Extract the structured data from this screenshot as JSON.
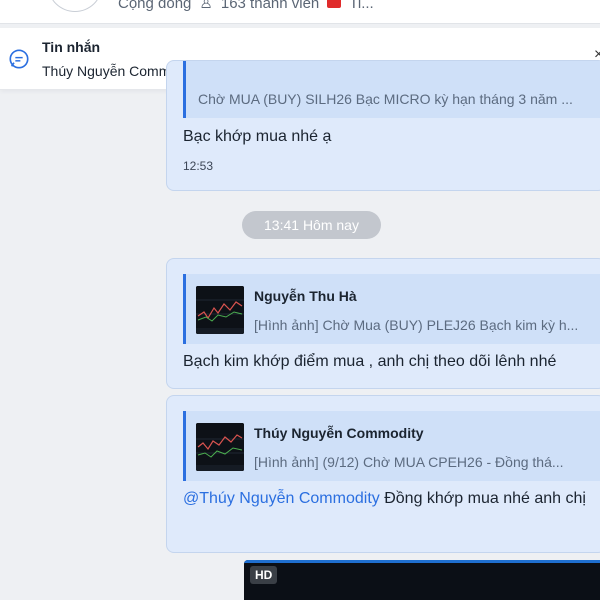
{
  "group_header": {
    "community_label": "Cộng đồng",
    "members_label": "163 thành viên",
    "extra_label": "Ti..."
  },
  "notification": {
    "title": "Tin nhắn",
    "preview": "Thúy Nguyễn Commodity: @All Chào anh chị , Thời gian tới, Em có điều ch..."
  },
  "messages": [
    {
      "quote_text": "Chờ MUA (BUY) SILH26 Bạc MICRO kỳ hạn tháng 3 năm ...",
      "text": "Bạc khớp mua nhé ạ",
      "time": "12:53"
    },
    {
      "quote_name": "Nguyễn Thu Hà",
      "quote_text": "[Hình ảnh] Chờ Mua (BUY) PLEJ26 Bạch kim kỳ h...",
      "text": "Bạch kim khớp điểm mua , anh chị theo dõi lênh nhé"
    },
    {
      "quote_name": "Thúy Nguyễn Commodity",
      "quote_text": "[Hình ảnh] (9/12) Chờ MUA CPEH26 - Đồng thá...",
      "mention": "@Thúy Nguyễn Commodity",
      "text": " Đồng khớp mua nhé anh chị"
    }
  ],
  "date_divider": "13:41 Hôm nay",
  "video": {
    "badge": "HD"
  },
  "colors": {
    "accent": "#2b6fe0",
    "bubble": "#dfeafb",
    "quote_bg": "#cfe0f8",
    "divider": "#c3c7ce"
  }
}
